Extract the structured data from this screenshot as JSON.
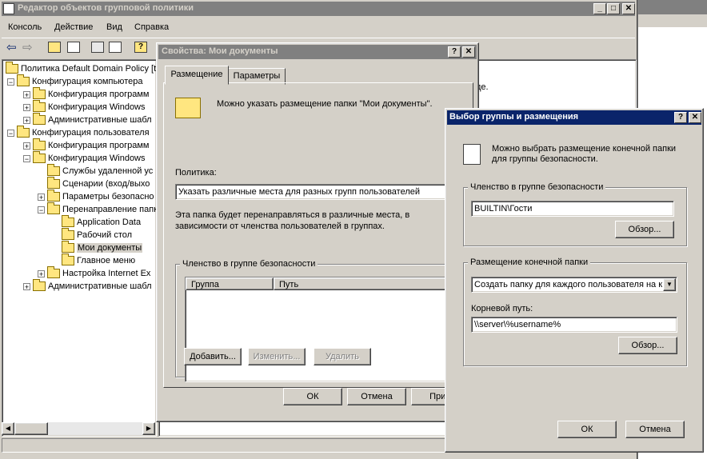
{
  "main_window": {
    "title": "Редактор объектов групповой политики",
    "menu": [
      "Консоль",
      "Действие",
      "Вид",
      "Справка"
    ],
    "tree": [
      {
        "label": "Политика Default Domain Policy [t",
        "level": 0
      },
      {
        "label": "Конфигурация компьютера",
        "level": 1
      },
      {
        "label": "Конфигурация программ",
        "level": 2
      },
      {
        "label": "Конфигурация Windows",
        "level": 2
      },
      {
        "label": "Административные шабл",
        "level": 2
      },
      {
        "label": "Конфигурация пользователя",
        "level": 1
      },
      {
        "label": "Конфигурация программ",
        "level": 2
      },
      {
        "label": "Конфигурация Windows",
        "level": 2
      },
      {
        "label": "Службы удаленной ус",
        "level": 3
      },
      {
        "label": "Сценарии (вход/выхо",
        "level": 3
      },
      {
        "label": "Параметры безопасно",
        "level": 3
      },
      {
        "label": "Перенаправление папк",
        "level": 3
      },
      {
        "label": "Application Data",
        "level": 4
      },
      {
        "label": "Рабочий стол",
        "level": 4
      },
      {
        "label": "Мои документы",
        "level": 4,
        "selected": true
      },
      {
        "label": "Главное меню",
        "level": 4
      },
      {
        "label": "Настройка Internet Ex",
        "level": 3
      },
      {
        "label": "Административные шабл",
        "level": 2
      }
    ],
    "right_pane_text": "де."
  },
  "props_dialog": {
    "title": "Свойства: Мои документы",
    "tabs": [
      "Размещение",
      "Параметры"
    ],
    "intro": "Можно указать размещение папки \"Мои документы\".",
    "policy_label": "Политика:",
    "policy_value": "Указать различные места для разных групп пользователей",
    "description": "Эта папка будет перенаправляться в различные места, в зависимости от членства пользователей в группах.",
    "group_title": "Членство в группе безопасности",
    "columns": [
      "Группа",
      "Путь"
    ],
    "buttons": {
      "add": "Добавить...",
      "edit": "Изменить...",
      "delete": "Удалить"
    },
    "footer": {
      "ok": "ОК",
      "cancel": "Отмена",
      "apply": "Приме"
    }
  },
  "group_dialog": {
    "title": "Выбор группы и размещения",
    "intro": "Можно выбрать размещение конечной папки для группы безопасности.",
    "membership_title": "Членство в группе безопасности",
    "membership_value": "BUILTIN\\Гости",
    "browse1": "Обзор...",
    "location_title": "Размещение конечной папки",
    "location_value": "Создать папку для каждого пользователя на к",
    "root_label": "Корневой путь:",
    "root_value": "\\\\server\\%username%",
    "browse2": "Обзор...",
    "ok": "ОК",
    "cancel": "Отмена"
  }
}
